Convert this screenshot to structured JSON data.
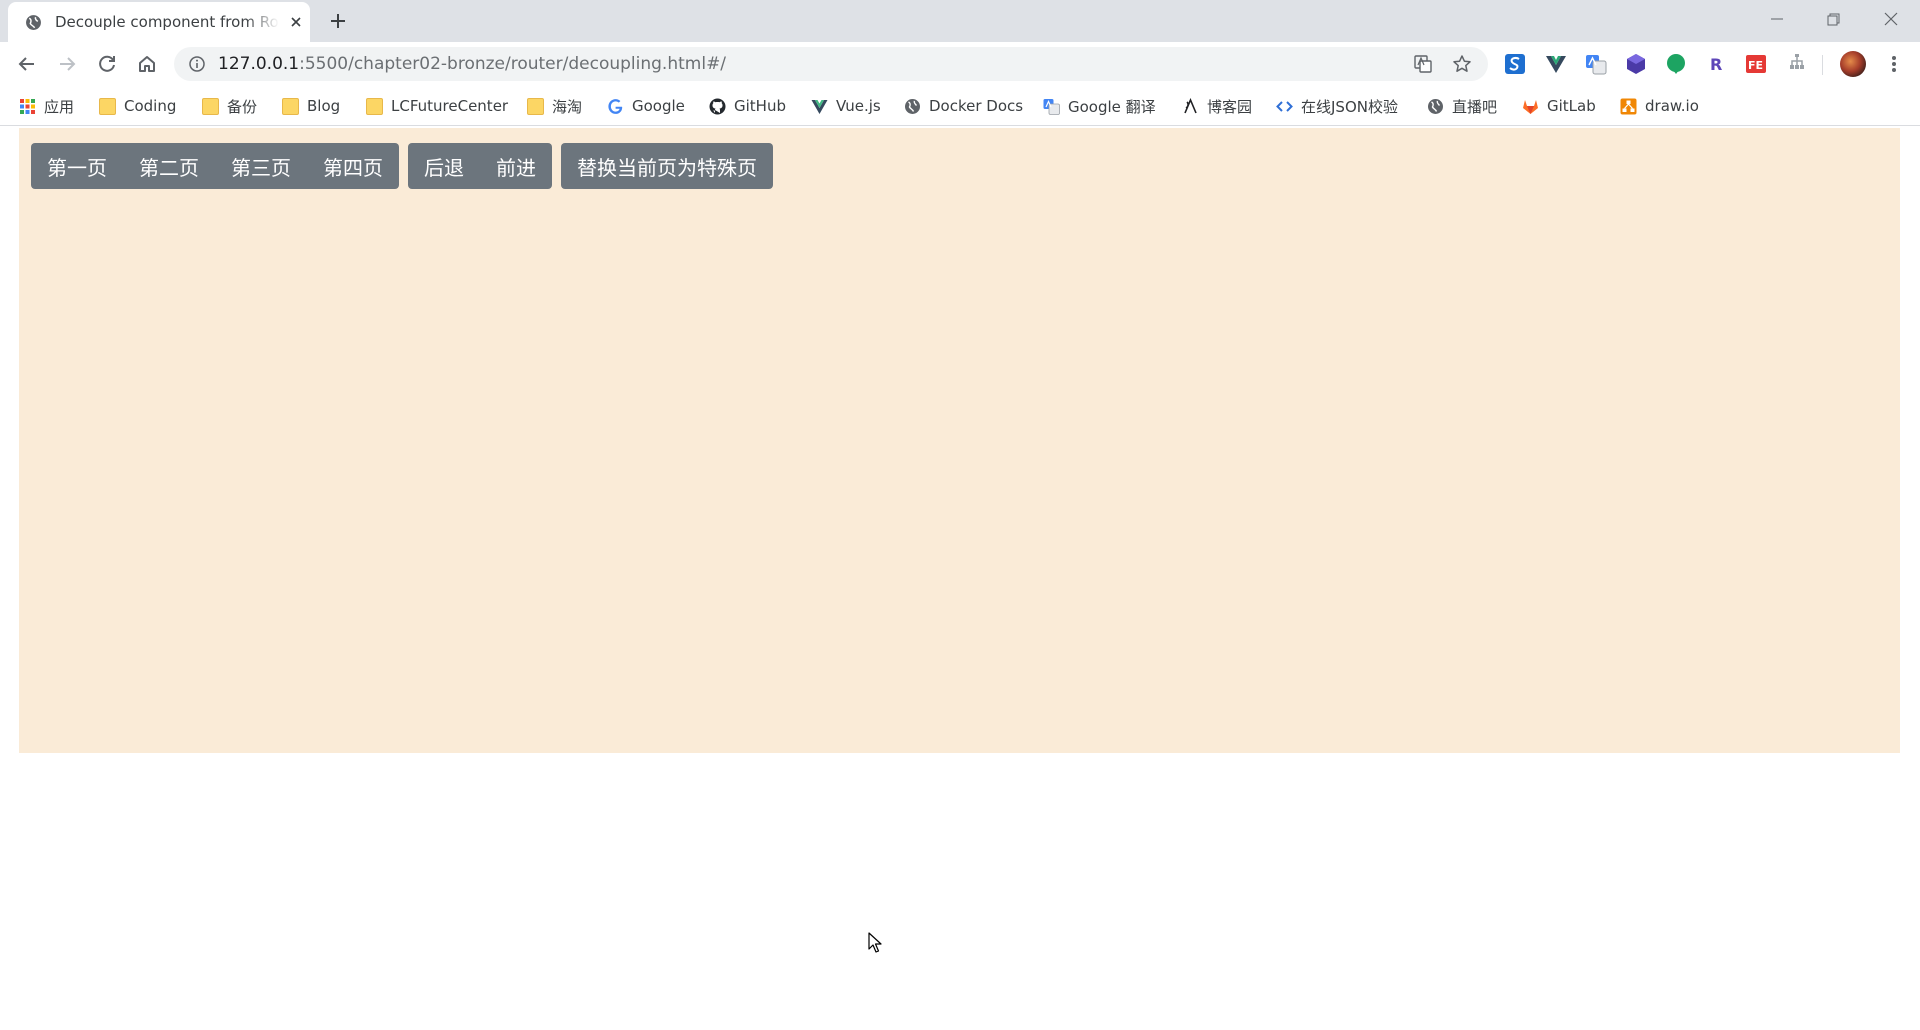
{
  "tab": {
    "title": "Decouple component from Ro",
    "close_glyph": "×",
    "new_tab_glyph": "+"
  },
  "toolbar": {
    "url_host": "127.0.0.1",
    "url_rest": ":5500/chapter02-bronze/router/decoupling.html#/"
  },
  "bookmarks": [
    {
      "label": "应用",
      "icon": "apps-grid-icon"
    },
    {
      "label": "Coding",
      "icon": "folder-icon"
    },
    {
      "label": "备份",
      "icon": "folder-icon"
    },
    {
      "label": "Blog",
      "icon": "folder-icon"
    },
    {
      "label": "LCFutureCenter",
      "icon": "folder-icon"
    },
    {
      "label": "海淘",
      "icon": "folder-icon"
    },
    {
      "label": "Google",
      "icon": "google-icon"
    },
    {
      "label": "GitHub",
      "icon": "github-icon"
    },
    {
      "label": "Vue.js",
      "icon": "vue-icon"
    },
    {
      "label": "Docker Docs",
      "icon": "globe-icon"
    },
    {
      "label": "Google 翻译",
      "icon": "google-translate-icon"
    },
    {
      "label": "博客园",
      "icon": "cnblogs-icon"
    },
    {
      "label": "在线JSON校验",
      "icon": "code-icon"
    },
    {
      "label": "直播吧",
      "icon": "globe-icon"
    },
    {
      "label": "GitLab",
      "icon": "gitlab-icon"
    },
    {
      "label": "draw.io",
      "icon": "drawio-icon"
    }
  ],
  "page": {
    "nav_buttons": [
      "第一页",
      "第二页",
      "第三页",
      "第四页"
    ],
    "history_buttons": [
      "后退",
      "前进"
    ],
    "replace_button": "替换当前页为特殊页"
  },
  "colors": {
    "app_background": "#faebd7",
    "button_background": "#6c757d",
    "button_text": "#ffffff",
    "tabstrip": "#dee1e6",
    "omnibox": "#f1f3f4"
  }
}
